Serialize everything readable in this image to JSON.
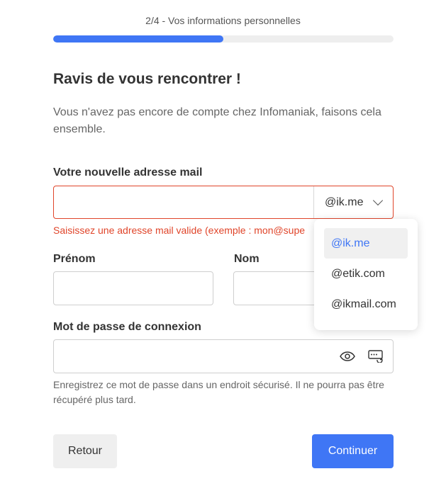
{
  "progress": {
    "step_label": "2/4 - Vos informations personnelles",
    "fraction": 0.5,
    "color": "#3f76f5"
  },
  "heading": {
    "title": "Ravis de vous rencontrer !",
    "intro": "Vous n'avez pas encore de compte chez Infomaniak, faisons cela ensemble."
  },
  "email": {
    "label": "Votre nouvelle adresse mail",
    "value": "",
    "selected_domain": "@ik.me",
    "error": "Saisissez une adresse mail valide (exemple : mon@supe",
    "error_color": "#e0452a",
    "domain_options": [
      "@ik.me",
      "@etik.com",
      "@ikmail.com"
    ]
  },
  "firstname": {
    "label": "Prénom",
    "value": ""
  },
  "lastname": {
    "label": "Nom",
    "value": ""
  },
  "password": {
    "label": "Mot de passe de connexion",
    "value": "",
    "help": "Enregistrez ce mot de passe dans un endroit sécurisé. Il ne pourra pas être récupéré plus tard.",
    "icons": [
      "eye-icon",
      "password-generator-icon"
    ]
  },
  "actions": {
    "back_label": "Retour",
    "continue_label": "Continuer"
  }
}
